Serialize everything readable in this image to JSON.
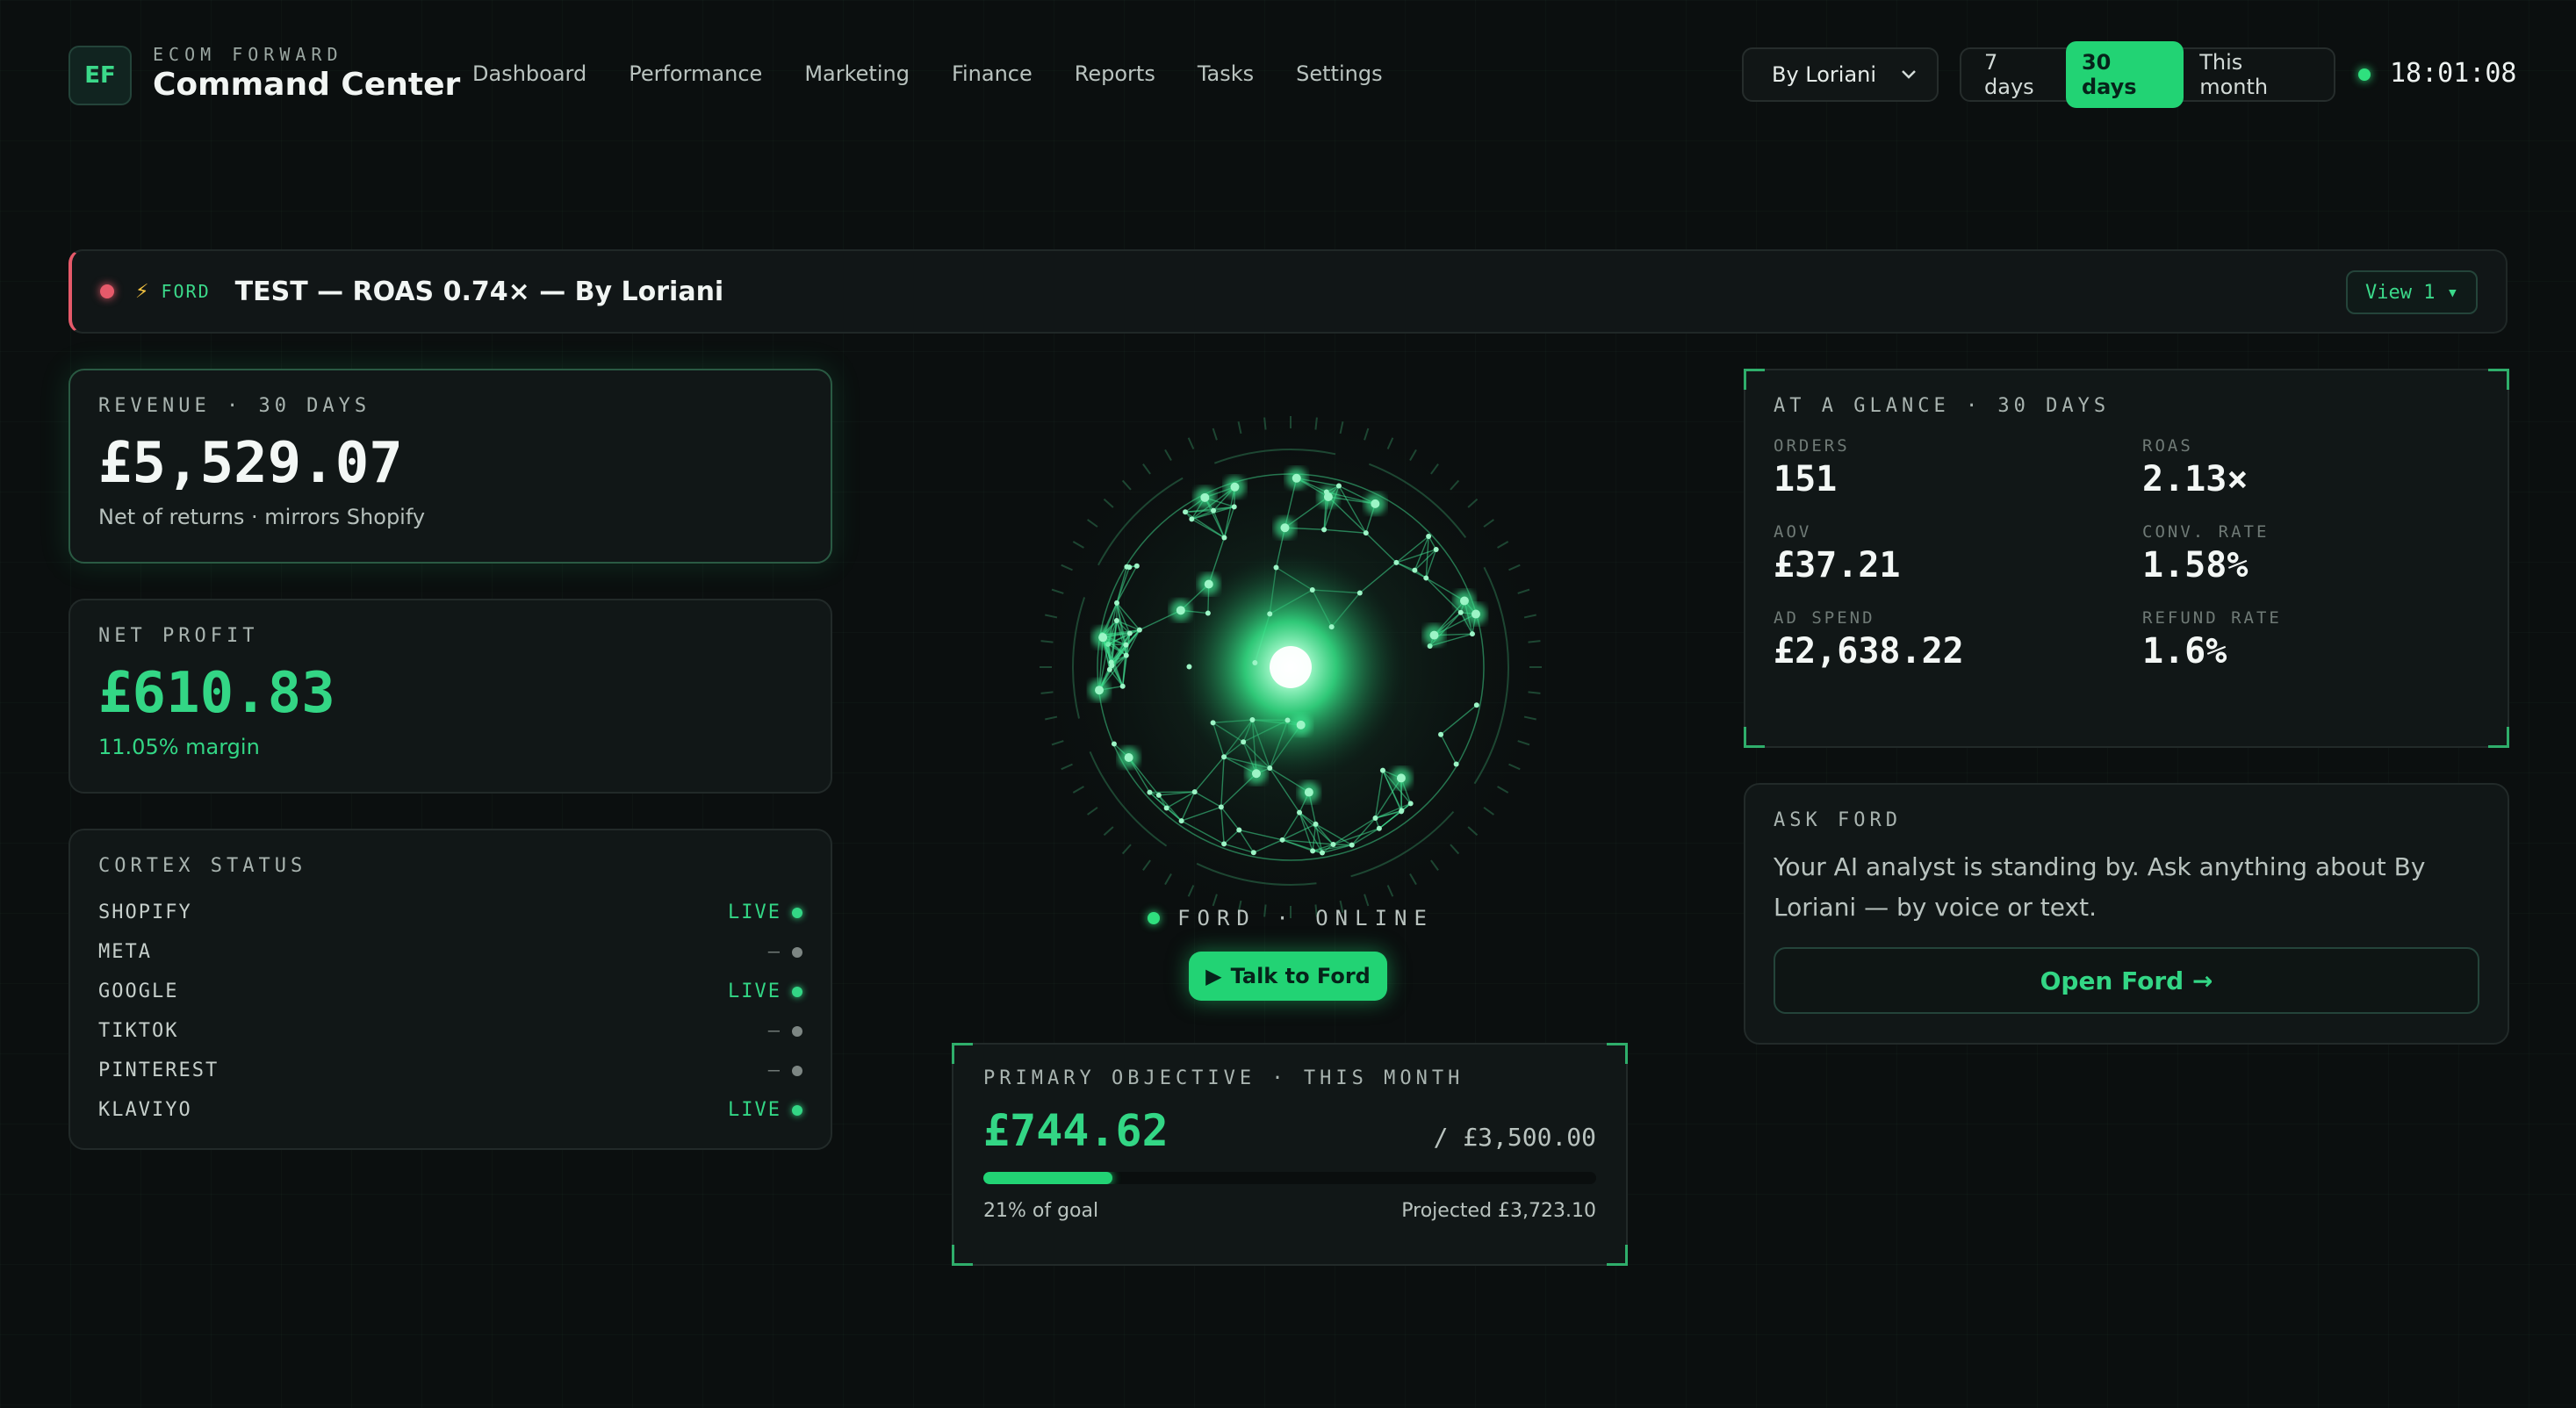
{
  "brand": {
    "logo": "EF",
    "eyebrow": "ECOM FORWARD",
    "title": "Command Center"
  },
  "nav": [
    "Dashboard",
    "Performance",
    "Marketing",
    "Finance",
    "Reports",
    "Tasks",
    "Settings"
  ],
  "store_select": {
    "value": "By Loriani"
  },
  "date_range": {
    "options": [
      "7 days",
      "30 days",
      "This month"
    ],
    "active": "30 days"
  },
  "clock": "18:01:08",
  "alert": {
    "tag": "FORD",
    "text": "TEST — ROAS 0.74× — By Loriani",
    "button": "View 1 ▾"
  },
  "revenue": {
    "label": "REVENUE · 30 DAYS",
    "value": "£5,529.07",
    "sub": "Net of returns · mirrors Shopify"
  },
  "profit": {
    "label": "NET PROFIT",
    "value": "£610.83",
    "sub": "11.05% margin"
  },
  "cortex": {
    "label": "CORTEX STATUS",
    "rows": [
      {
        "name": "SHOPIFY",
        "status": "LIVE"
      },
      {
        "name": "META",
        "status": "—"
      },
      {
        "name": "GOOGLE",
        "status": "LIVE"
      },
      {
        "name": "TIKTOK",
        "status": "—"
      },
      {
        "name": "PINTEREST",
        "status": "—"
      },
      {
        "name": "KLAVIYO",
        "status": "LIVE"
      }
    ]
  },
  "glance": {
    "label": "AT A GLANCE · 30 DAYS",
    "stats": [
      {
        "label": "ORDERS",
        "value": "151"
      },
      {
        "label": "ROAS",
        "value": "2.13×"
      },
      {
        "label": "AOV",
        "value": "£37.21"
      },
      {
        "label": "CONV. RATE",
        "value": "1.58%"
      },
      {
        "label": "AD SPEND",
        "value": "£2,638.22"
      },
      {
        "label": "REFUND RATE",
        "value": "1.6%"
      }
    ]
  },
  "ask": {
    "label": "ASK FORD",
    "text": "Your AI analyst is standing by. Ask anything about By Loriani — by voice or text.",
    "button": "Open Ford →"
  },
  "orb": {
    "status": "FORD · ONLINE",
    "button": "Talk to Ford"
  },
  "objective": {
    "label": "PRIMARY OBJECTIVE · THIS MONTH",
    "value": "£744.62",
    "goal": "/ £3,500.00",
    "progress": 0.21,
    "progress_text": "21% of goal",
    "projected": "Projected £3,723.10"
  },
  "colors": {
    "accent": "#22d374",
    "alert": "#e65a6a",
    "background": "#0b0f0f"
  }
}
